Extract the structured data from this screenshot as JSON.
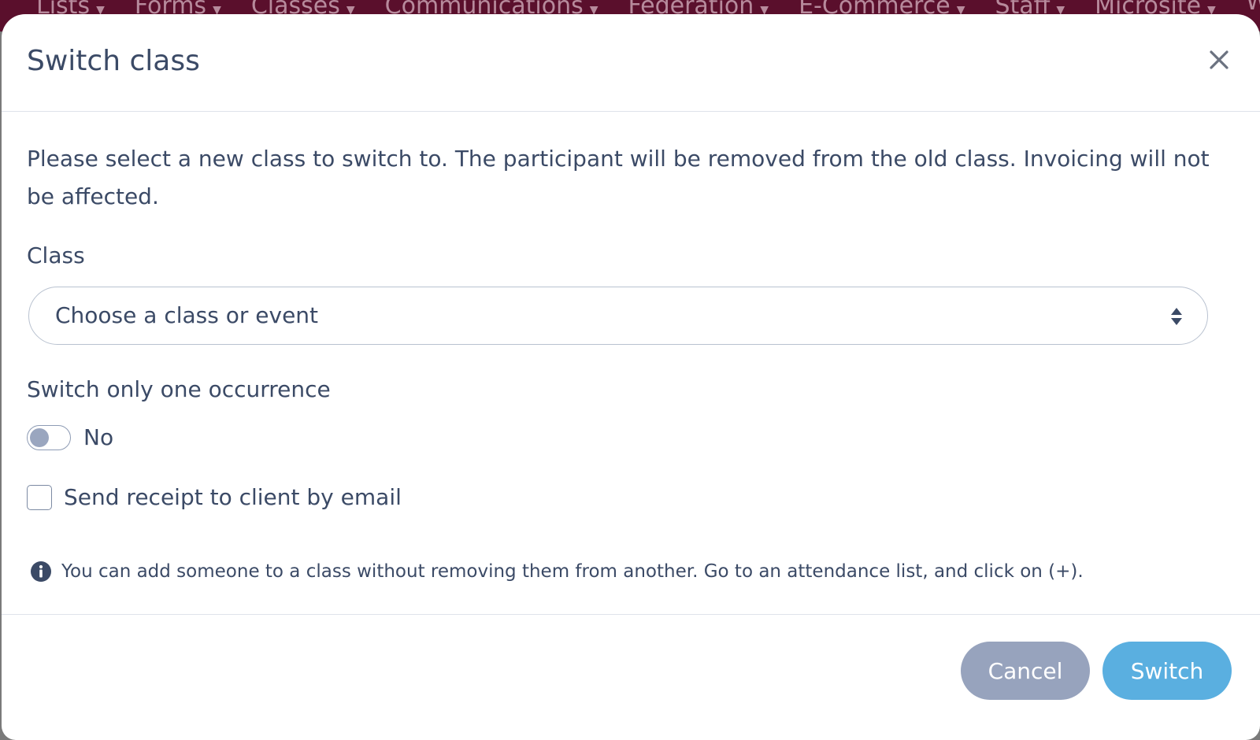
{
  "background_nav": {
    "items": [
      "Lists",
      "Forms",
      "Classes",
      "Communications",
      "Federation",
      "E-Commerce",
      "Staff",
      "Microsite",
      "W"
    ]
  },
  "modal": {
    "title": "Switch class",
    "close_icon": "close-icon",
    "intro": "Please select a new class to switch to. The participant will be removed from the old class. Invoicing will not be affected.",
    "class_field": {
      "label": "Class",
      "selected_value": "Choose a class or event"
    },
    "occurrence_field": {
      "label": "Switch only one occurrence",
      "toggle_state": "No"
    },
    "receipt_checkbox": {
      "label": "Send receipt to client by email",
      "checked": false
    },
    "info": {
      "icon": "info-icon",
      "text": "You can add someone to a class without removing them from another. Go to an attendance list, and click on (+)."
    },
    "footer": {
      "cancel_label": "Cancel",
      "switch_label": "Switch"
    }
  },
  "colors": {
    "text": "#3b4a66",
    "cancel_bg": "#97a3bd",
    "switch_bg": "#5aafe0",
    "nav_bg": "#5a0f2c"
  }
}
